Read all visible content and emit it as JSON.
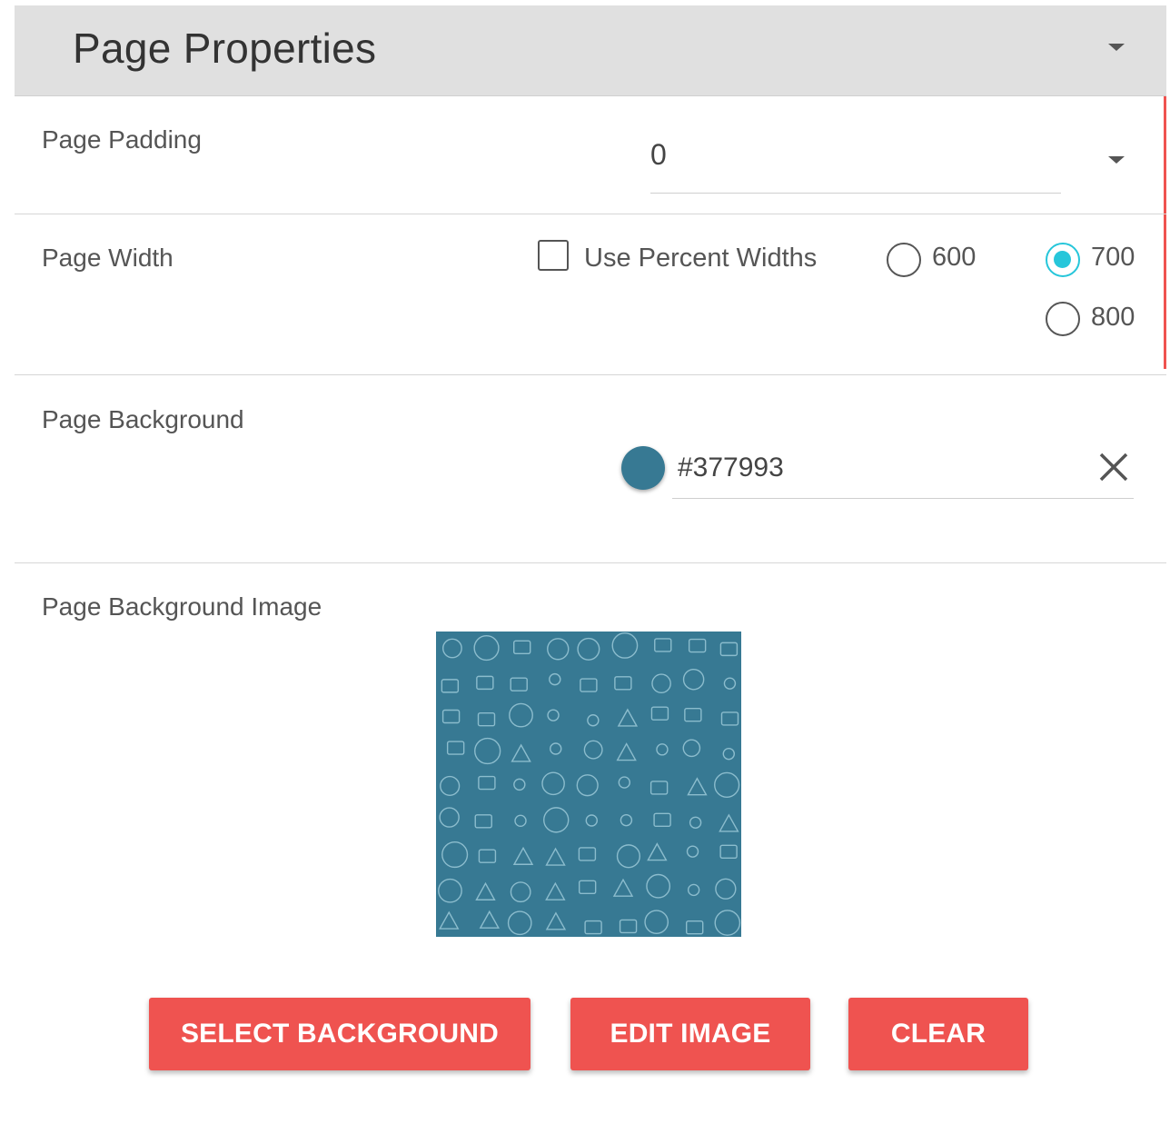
{
  "header": {
    "title": "Page Properties",
    "icon": "chevron-down-icon"
  },
  "padding": {
    "label": "Page Padding",
    "value": "0"
  },
  "width": {
    "label": "Page Width",
    "percent_label": "Use Percent Widths",
    "percent_checked": false,
    "options": [
      {
        "label": "600",
        "checked": false
      },
      {
        "label": "700",
        "checked": true
      },
      {
        "label": "800",
        "checked": false
      }
    ]
  },
  "background": {
    "label": "Page Background",
    "value": "#377993",
    "swatch_color": "#377993",
    "clear_icon": "close-icon"
  },
  "background_image": {
    "label": "Page Background Image",
    "tile_color": "#377993",
    "pattern_color": "#a8d3e0"
  },
  "buttons": {
    "select_label": "SELECT BACKGROUND",
    "edit_label": "EDIT IMAGE",
    "clear_label": "CLEAR"
  },
  "colors": {
    "accent": "#ef5350",
    "radio_active": "#26c6da",
    "header_bg": "#e0e0e0"
  }
}
